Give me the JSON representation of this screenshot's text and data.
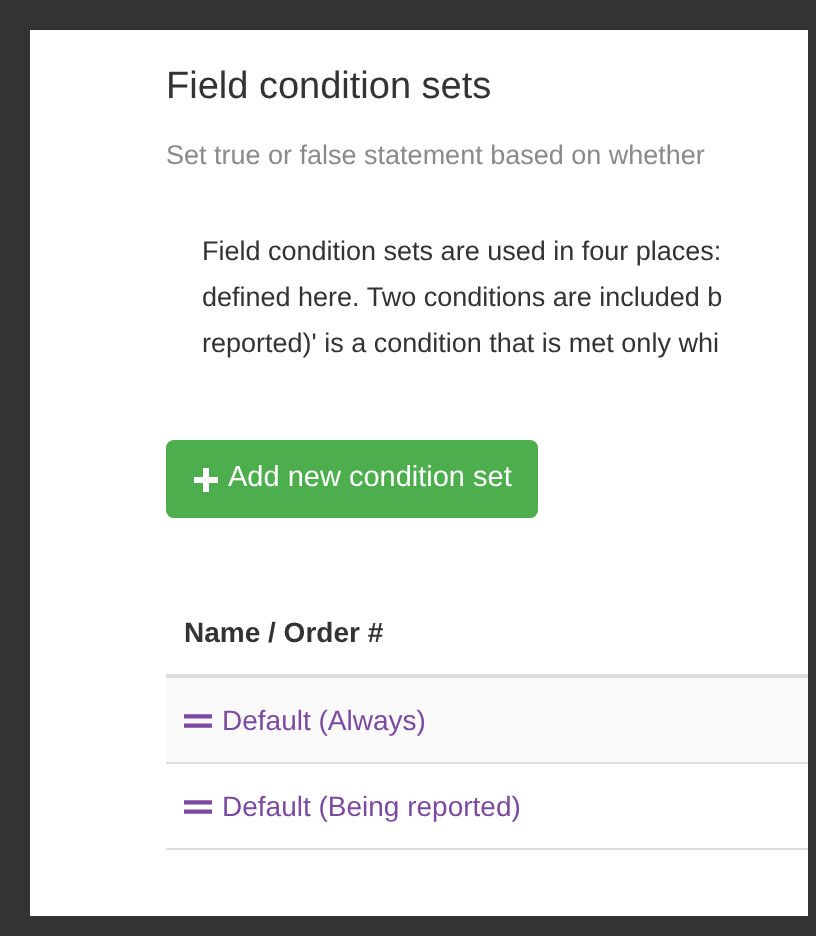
{
  "title": "Field condition sets",
  "subtitle": "Set true or false statement based on whether",
  "description_lines": [
    "Field condition sets are used in four places:",
    "defined here. Two conditions are included b",
    "reported)' is a condition that is met only whi"
  ],
  "add_button": {
    "label": "Add new condition set"
  },
  "table": {
    "columns": [
      "Name / Order #"
    ],
    "rows": [
      {
        "name": "Default (Always)"
      },
      {
        "name": "Default (Being reported)"
      }
    ]
  }
}
